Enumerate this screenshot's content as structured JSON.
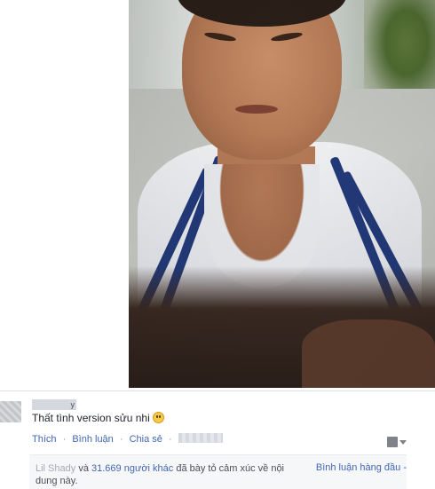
{
  "comment": {
    "author": "y",
    "text": "Thất tình version sửu nhi",
    "emoji_icon": "smiley-emoji-icon"
  },
  "actions": {
    "like": "Thích",
    "comment": "Bình luận",
    "share": "Chia sẻ",
    "separator": "·"
  },
  "reactions": {
    "first_name": "Lil Shady",
    "connector": "và",
    "others": "31.669 người khác",
    "rest": "đã bày tỏ cảm xúc về nội dung này."
  },
  "sort": {
    "label": "Bình luận hàng đầu -"
  },
  "colors": {
    "link": "#4267b2",
    "text": "#1d2129",
    "muted": "#90949c",
    "bar_bg": "#f6f7f9"
  }
}
